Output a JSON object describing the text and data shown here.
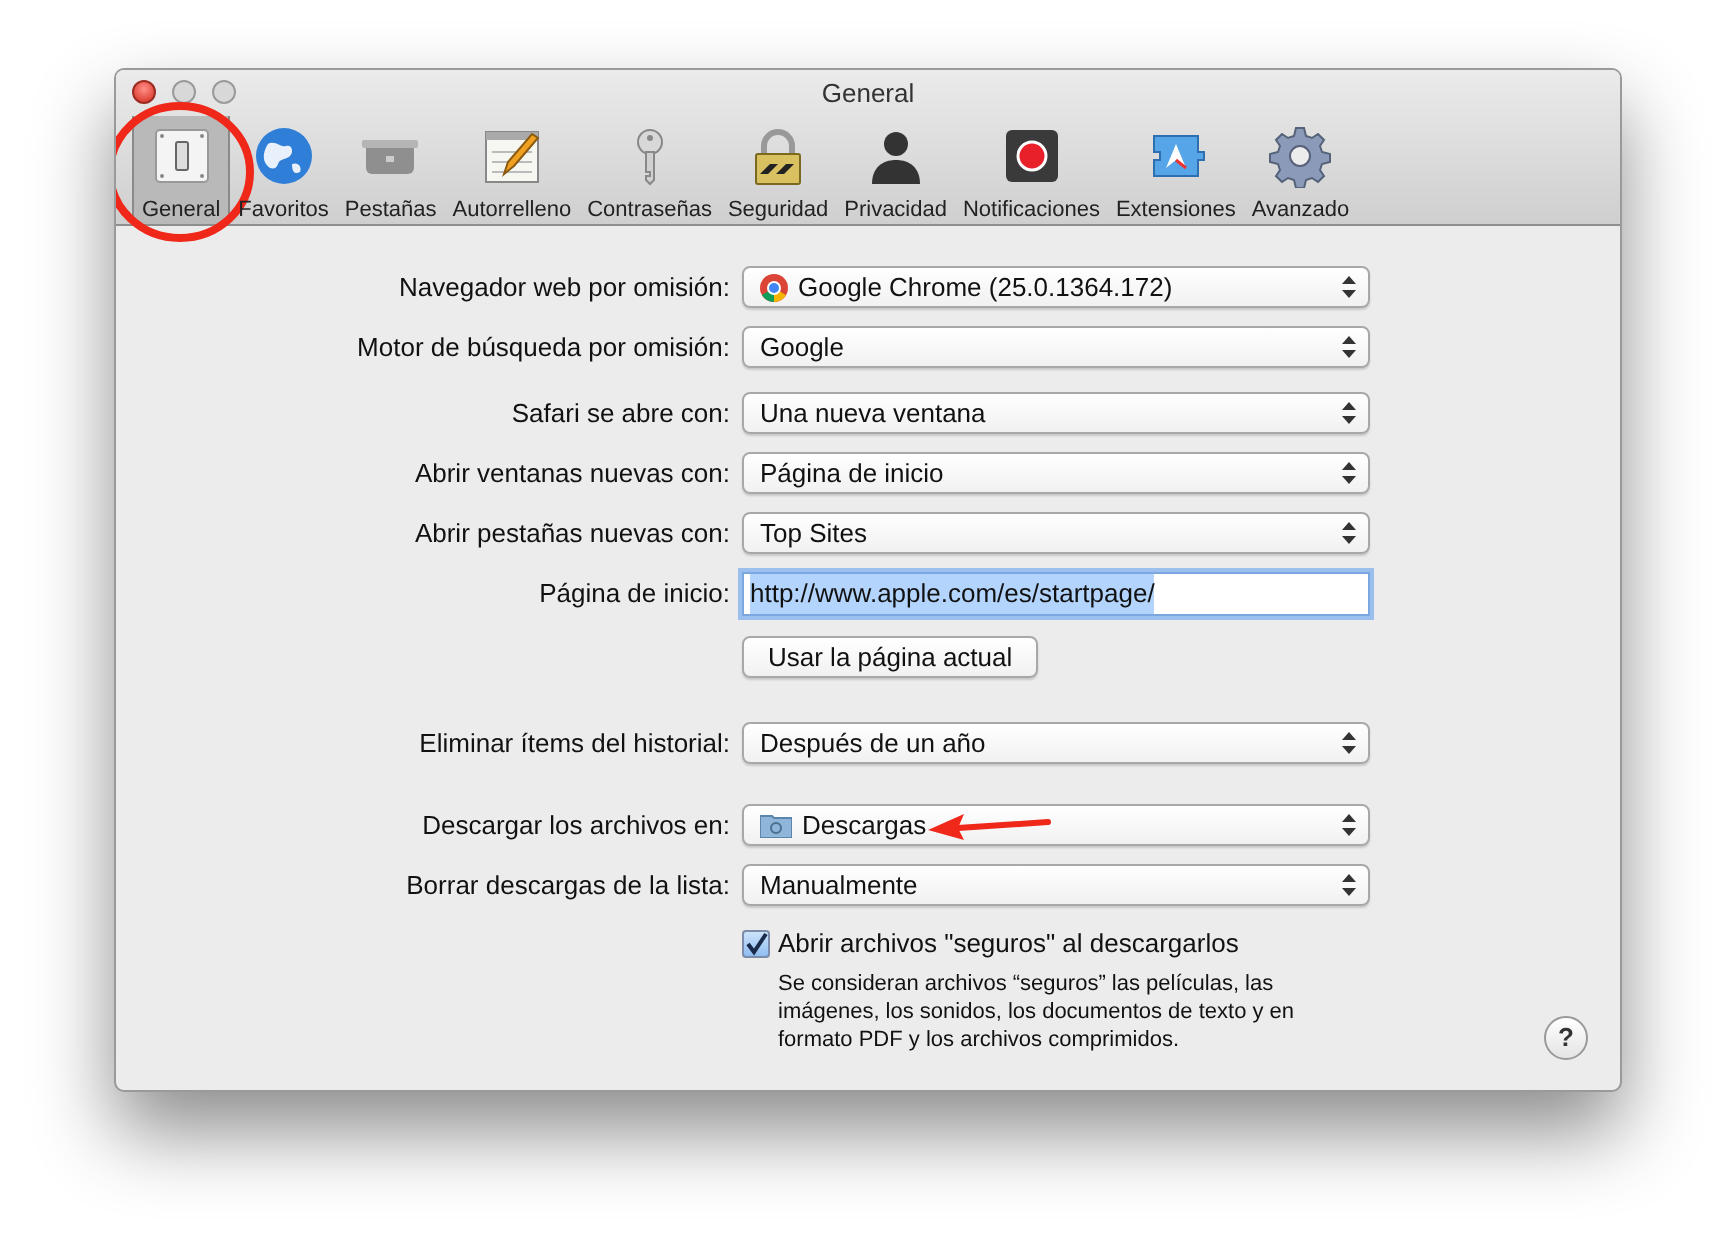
{
  "window": {
    "title": "General"
  },
  "toolbar": [
    {
      "label": "General",
      "kind": "switch",
      "selected": true,
      "circled": true
    },
    {
      "label": "Favoritos",
      "kind": "globe",
      "selected": false
    },
    {
      "label": "Pestañas",
      "kind": "tabs",
      "selected": false
    },
    {
      "label": "Autorrelleno",
      "kind": "pencil",
      "selected": false
    },
    {
      "label": "Contraseñas",
      "kind": "key",
      "selected": false
    },
    {
      "label": "Seguridad",
      "kind": "lock",
      "selected": false
    },
    {
      "label": "Privacidad",
      "kind": "person",
      "selected": false
    },
    {
      "label": "Notificaciones",
      "kind": "record",
      "selected": false
    },
    {
      "label": "Extensiones",
      "kind": "puzzle",
      "selected": false
    },
    {
      "label": "Avanzado",
      "kind": "gear",
      "selected": false
    }
  ],
  "sections": [
    [
      {
        "label": "Navegador web por omisión:",
        "kind": "browser_popup",
        "value": "Google Chrome (25.0.1364.172)"
      },
      {
        "label": "Motor de búsqueda por omisión:",
        "kind": "popup",
        "value": "Google"
      }
    ],
    [
      {
        "label": "Safari se abre con:",
        "kind": "popup",
        "value": "Una nueva ventana"
      },
      {
        "label": "Abrir ventanas nuevas con:",
        "kind": "popup",
        "value": "Página de inicio"
      },
      {
        "label": "Abrir pestañas nuevas con:",
        "kind": "popup",
        "value": "Top Sites"
      },
      {
        "label": "Página de inicio:",
        "kind": "field",
        "value": "http://www.apple.com/es/startpage/"
      },
      {
        "kind": "button",
        "value": "Usar la página actual"
      }
    ],
    [
      {
        "label": "Eliminar ítems del historial:",
        "kind": "popup",
        "value": "Después de un año"
      }
    ],
    [
      {
        "label": "Descargar los archivos en:",
        "kind": "folder_popup",
        "value": "Descargas",
        "arrow": true
      },
      {
        "label": "Borrar descargas de la lista:",
        "kind": "popup",
        "value": "Manualmente"
      },
      {
        "kind": "checkbox",
        "value": "Abrir archivos \"seguros\" al descargarlos",
        "checked": true,
        "description": "Se consideran archivos “seguros” las películas, las imágenes, los sonidos, los documentos de texto y en formato PDF y los archivos comprimidos."
      }
    ]
  ],
  "help_button": "?"
}
